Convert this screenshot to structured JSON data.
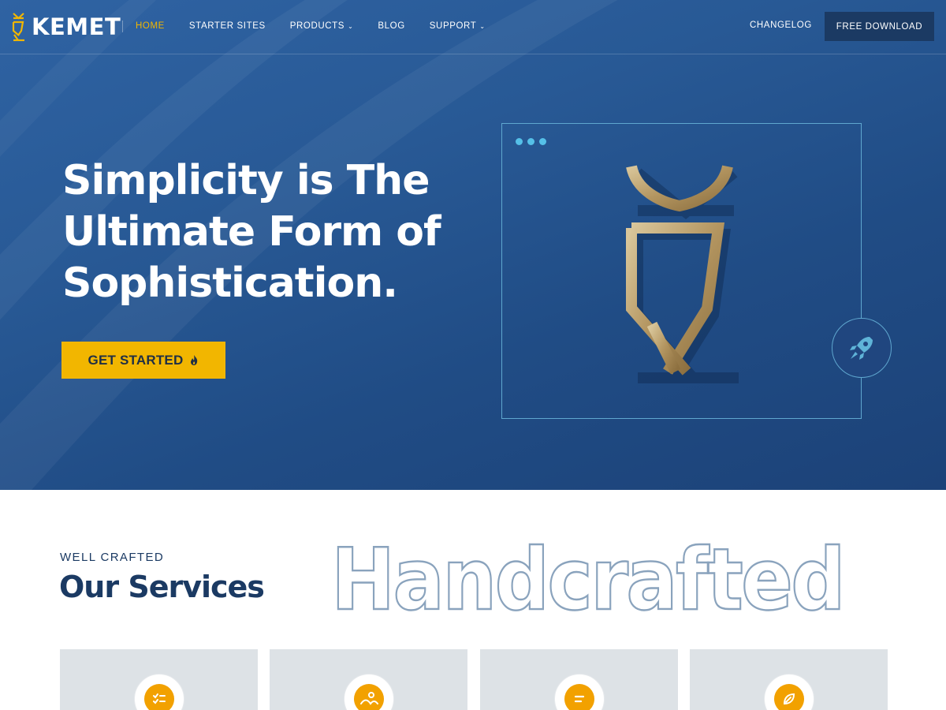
{
  "brand": {
    "name": "KEMET",
    "logo_icon": "kemet-emblem-icon",
    "accent": "#f1b600",
    "dark": "#1b3a63"
  },
  "nav": {
    "items": [
      {
        "label": "HOME",
        "active": true,
        "has_dropdown": false
      },
      {
        "label": "STARTER SITES",
        "active": false,
        "has_dropdown": false
      },
      {
        "label": "PRODUCTS",
        "active": false,
        "has_dropdown": true
      },
      {
        "label": "BLOG",
        "active": false,
        "has_dropdown": false
      },
      {
        "label": "SUPPORT",
        "active": false,
        "has_dropdown": true
      }
    ],
    "changelog": "CHANGELOG",
    "free_download": "FREE DOWNLOAD"
  },
  "hero": {
    "title_lines": [
      "Simplicity is The",
      "Ultimate Form of",
      "Sophistication."
    ],
    "cta_label": "GET STARTED",
    "cta_icon": "flame-icon",
    "frame_icon": "kemet-emblem-icon",
    "badge_icon": "rocket-icon"
  },
  "services": {
    "eyebrow": "WELL CRAFTED",
    "title": "Our Services",
    "outline_word": "Handcrafted",
    "cards": [
      {
        "icon": "checklist-icon"
      },
      {
        "icon": "image-icon"
      },
      {
        "icon": "text-lines-icon"
      },
      {
        "icon": "leaf-icon"
      }
    ]
  }
}
